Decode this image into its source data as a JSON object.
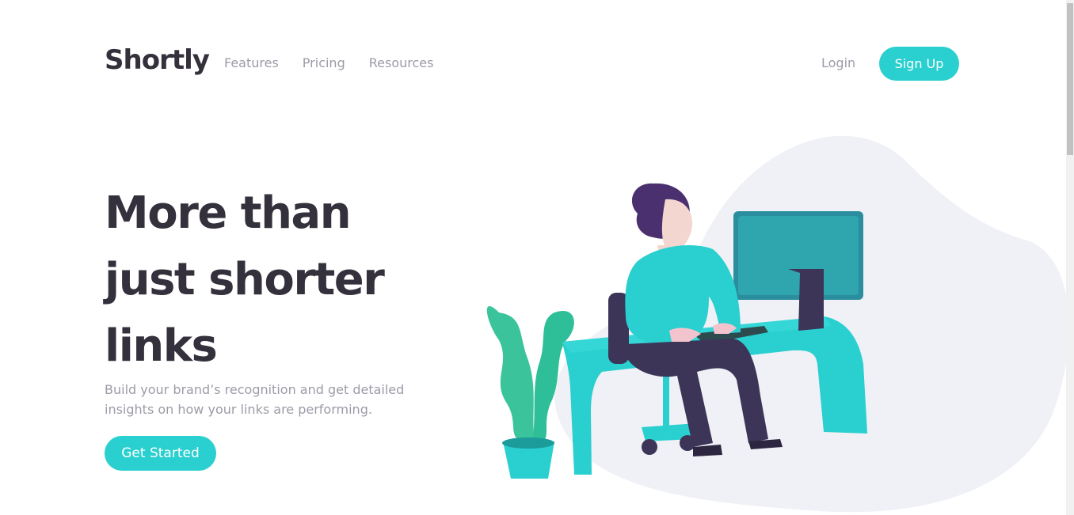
{
  "header": {
    "logo": "Shortly",
    "nav": [
      "Features",
      "Pricing",
      "Resources"
    ],
    "login": "Login",
    "signup": "Sign Up"
  },
  "hero": {
    "title_lines": [
      "More than",
      "just shorter",
      "links"
    ],
    "subtitle_lines": [
      "Build your brand’s recognition and get detailed",
      "insights on how your links are performing."
    ],
    "cta": "Get Started"
  },
  "colors": {
    "accent": "#2acfcf",
    "dark": "#34313d",
    "gray": "#9e9aa7",
    "blob": "#f0f1f6"
  },
  "illustration": "person-working-at-desk"
}
